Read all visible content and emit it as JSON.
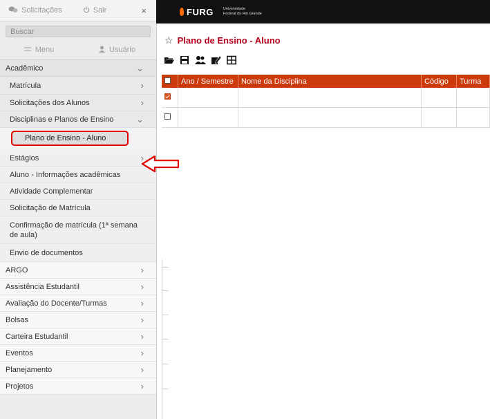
{
  "topbar": {
    "requests": "Solicitações",
    "exit": "Sair",
    "close": "×"
  },
  "search": {
    "placeholder": "Buscar"
  },
  "tabs": {
    "menu": "Menu",
    "user": "Usuário"
  },
  "menu": {
    "academico": "Acadêmico",
    "matricula": "Matrícula",
    "solicitacoes_alunos": "Solicitações dos Alunos",
    "disciplinas": "Disciplinas e Planos de Ensino",
    "plano_aluno": "Plano de Ensino - Aluno",
    "estagios": "Estágios",
    "aluno_info": "Aluno - Informações acadêmicas",
    "atividade": "Atividade Complementar",
    "solicitacao_matricula": "Solicitação de Matrícula",
    "confirmacao": "Confirmação de matrícula (1ª semana de aula)",
    "envio": "Envio de documentos",
    "argo": "ARGO",
    "assistencia": "Assistência Estudantil",
    "avaliacao": "Avaliação do Docente/Turmas",
    "bolsas": "Bolsas",
    "carteira": "Carteira Estudantil",
    "eventos": "Eventos",
    "planejamento": "Planejamento",
    "projetos": "Projetos"
  },
  "brand": {
    "name": "FURG",
    "line1": "Universidade",
    "line2": "Federal do Rio Grande"
  },
  "page": {
    "title": "Plano de Ensino - Aluno"
  },
  "table": {
    "columns": [
      "Ano / Semestre",
      "Nome da Disciplina",
      "Código",
      "Turma"
    ],
    "rows": [
      {
        "checked": true
      },
      {
        "checked": false
      }
    ]
  },
  "colors": {
    "header": "#cc3a0b",
    "title": "#b3001b",
    "highlight": "#e00000"
  }
}
